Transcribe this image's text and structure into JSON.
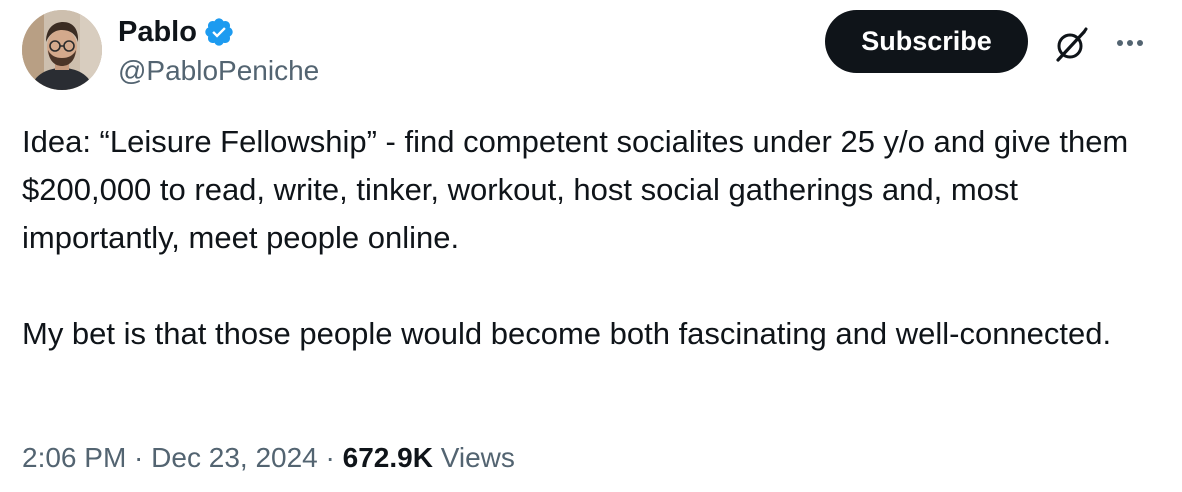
{
  "author": {
    "display_name": "Pablo",
    "handle": "@PabloPeniche",
    "verified": true,
    "avatar_icon": "person-photo-avatar"
  },
  "actions": {
    "subscribe_label": "Subscribe",
    "grok_icon": "grok-slash-icon",
    "more_icon": "more-horizontal-icon"
  },
  "tweet": {
    "paragraphs": [
      "Idea: “Leisure Fellowship” - find competent socialites under 25 y/o and give them $200,000 to read, write, tinker, workout, host social gatherings and, most importantly, meet people online.",
      "My bet is that those people would become both fascinating and well-connected."
    ]
  },
  "meta": {
    "time": "2:06 PM",
    "separator": " · ",
    "date": "Dec 23, 2024",
    "views_count": "672.9K",
    "views_label": "Views"
  },
  "colors": {
    "text_primary": "#0f1419",
    "text_secondary": "#536471",
    "verified_blue": "#1d9bf0",
    "button_bg": "#0f1419"
  }
}
